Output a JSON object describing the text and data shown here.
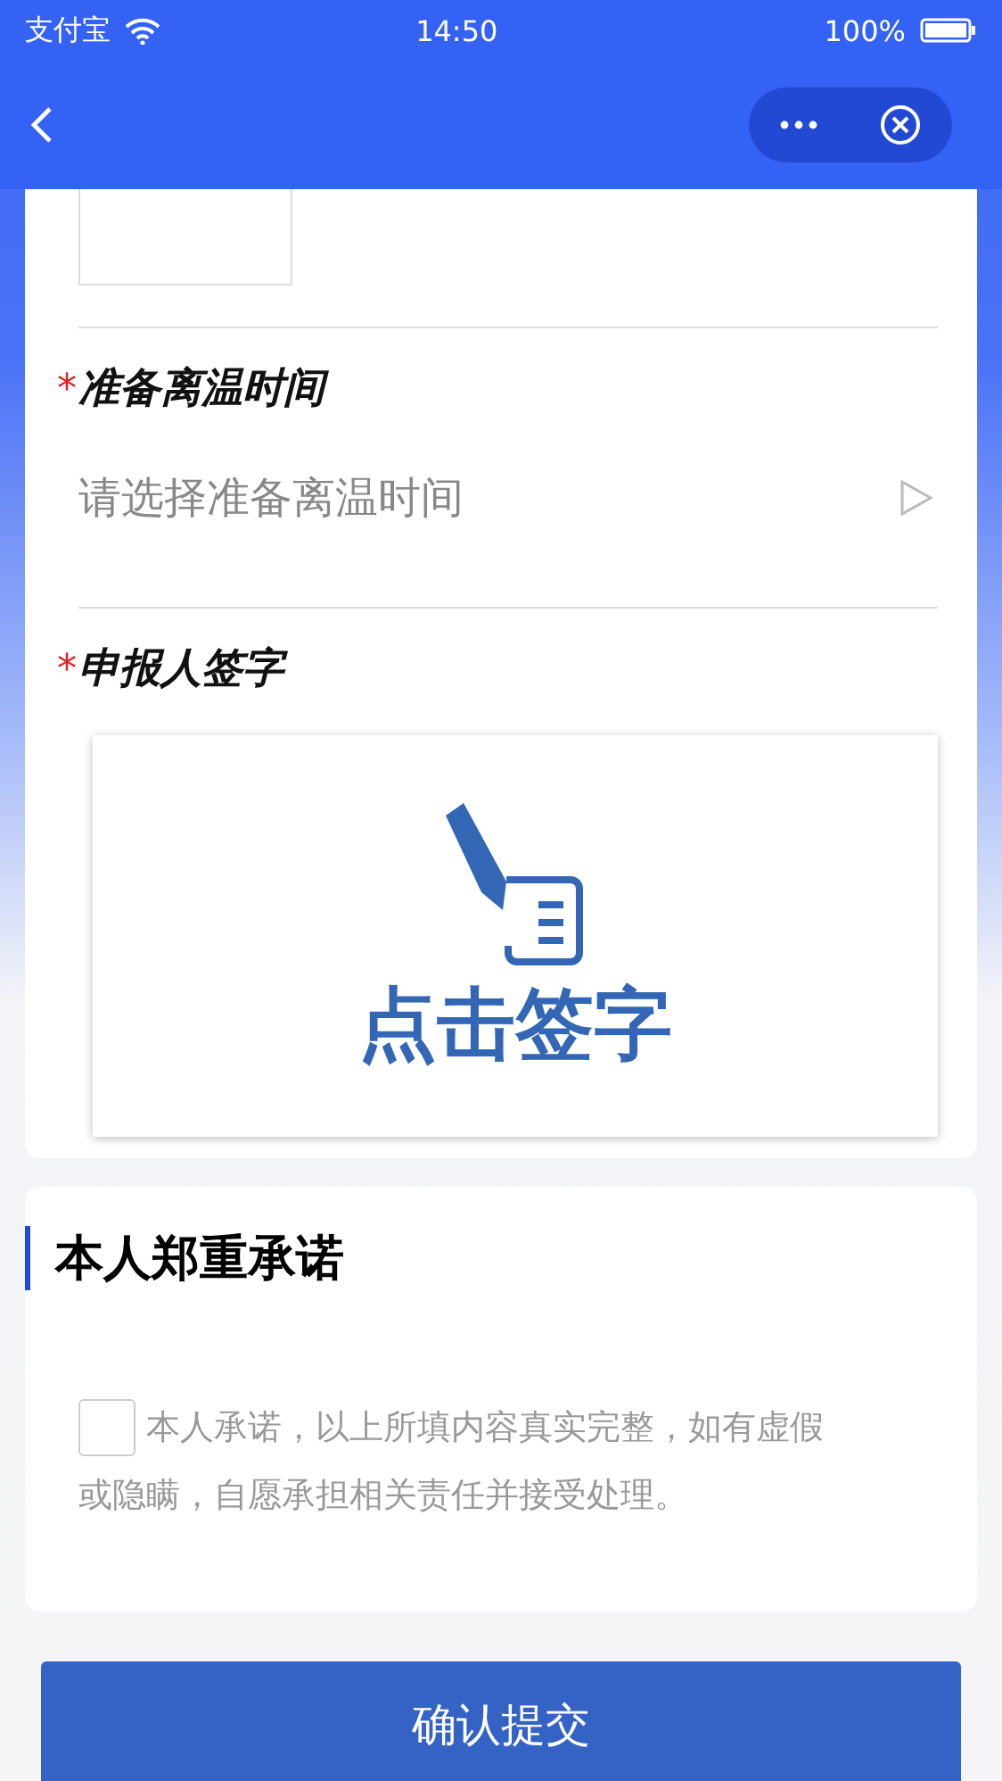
{
  "status_bar": {
    "carrier": "支付宝",
    "time": "14:50",
    "battery": "100%"
  },
  "form": {
    "fields": [
      {
        "kind": "picker",
        "required_mark": "*",
        "label": "准备离温时间",
        "placeholder": "请选择准备离温时间"
      },
      {
        "kind": "signature",
        "required_mark": "*",
        "label": "申报人签字",
        "action": "点击签字"
      }
    ]
  },
  "pledge": {
    "title": "本人郑重承诺",
    "checked": false,
    "text_lines": [
      "本人承诺，以上所填内容真实完整，如有虚假",
      "或隐瞒，自愿承担相关责任并接受处理。"
    ]
  },
  "submit": "确认提交"
}
